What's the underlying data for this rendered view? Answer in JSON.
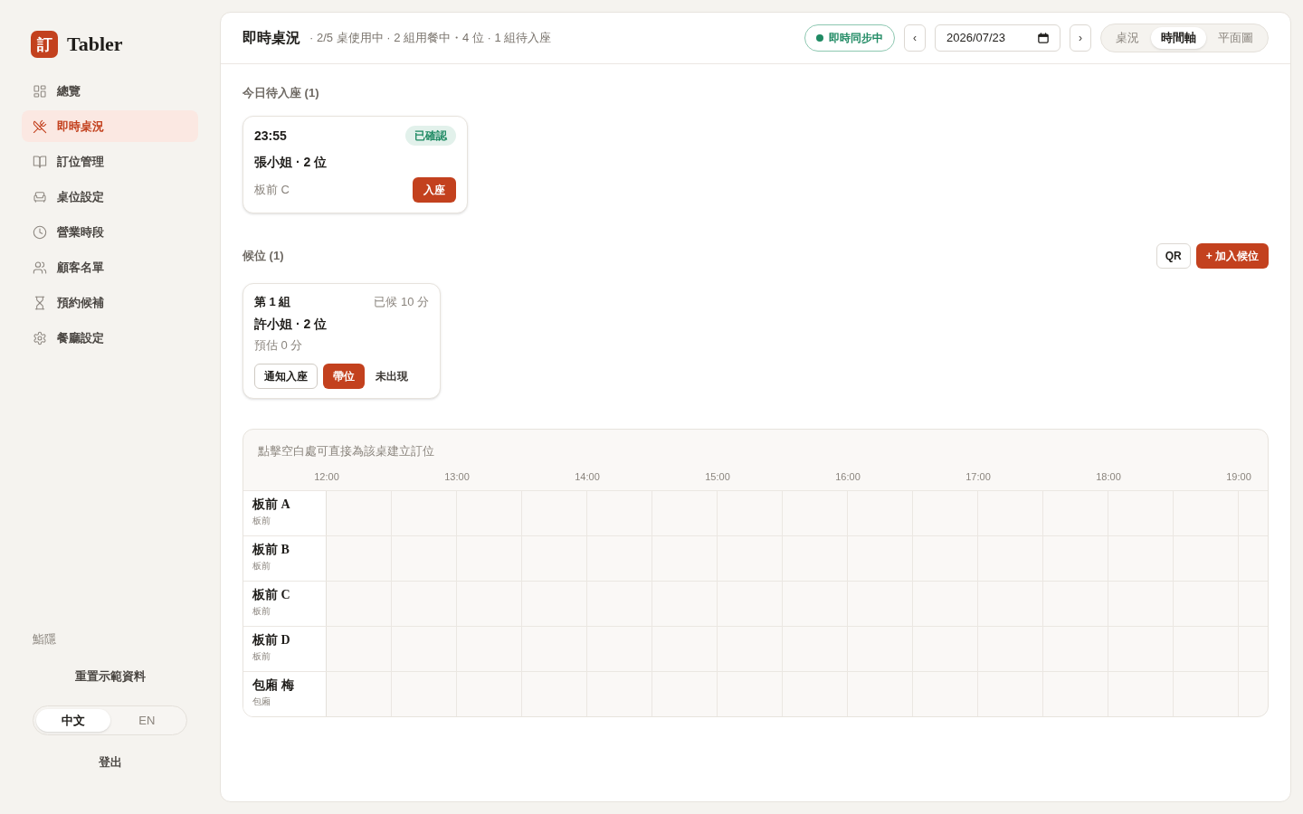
{
  "sidebar": {
    "logo": {
      "mark": "訂",
      "name": "Tabler"
    },
    "nav": [
      {
        "label": "總覽",
        "selected": false
      },
      {
        "label": "即時桌況",
        "selected": true
      },
      {
        "label": "訂位管理",
        "selected": false
      },
      {
        "label": "桌位設定",
        "selected": false
      },
      {
        "label": "營業時段",
        "selected": false
      },
      {
        "label": "顧客名單",
        "selected": false
      },
      {
        "label": "預約候補",
        "selected": false
      },
      {
        "label": "餐廳設定",
        "selected": false
      }
    ],
    "restaurant": "鮨隱",
    "reset_button": "重置示範資料",
    "languages": [
      {
        "label": "中文",
        "selected": true
      },
      {
        "label": "EN",
        "selected": false
      }
    ],
    "logout": "登出"
  },
  "header": {
    "title": "即時桌況",
    "summary": "· 2/5 桌使用中 · 2 組用餐中・4 位 · 1 組待入座",
    "sync_status": "即時同步中",
    "prev_button": "‹",
    "date": "2026/07/23",
    "next_button": "›",
    "views": [
      {
        "label": "桌況",
        "selected": false
      },
      {
        "label": "時間軸",
        "selected": true
      },
      {
        "label": "平面圖",
        "selected": false
      }
    ]
  },
  "arrivals": {
    "title": "今日待入座 (1)",
    "cards": [
      {
        "time": "23:55",
        "status": "已確認",
        "guest": "張小姐 · 2 位",
        "table": "板前 C",
        "action": "入座"
      }
    ]
  },
  "waitlist": {
    "title": "候位 (1)",
    "qr_button": "QR",
    "add_button": "+ 加入候位",
    "cards": [
      {
        "group": "第 1 組",
        "waited": "已候 10 分",
        "guest": "許小姐 · 2 位",
        "estimate": "預估 0 分",
        "actions": [
          {
            "label": "通知入座",
            "kind": "outline"
          },
          {
            "label": "帶位",
            "kind": "primary"
          },
          {
            "label": "未出現",
            "kind": "plain"
          }
        ]
      }
    ]
  },
  "timeline": {
    "hint": "點擊空白處可直接為該桌建立訂位",
    "hours": [
      "12:00",
      "13:00",
      "14:00",
      "15:00",
      "16:00",
      "17:00",
      "18:00",
      "19:00"
    ],
    "rows": [
      {
        "name": "板前 A",
        "zone": "板前"
      },
      {
        "name": "板前 B",
        "zone": "板前"
      },
      {
        "name": "板前 C",
        "zone": "板前"
      },
      {
        "name": "板前 D",
        "zone": "板前"
      },
      {
        "name": "包廂 梅",
        "zone": "包廂"
      }
    ]
  }
}
